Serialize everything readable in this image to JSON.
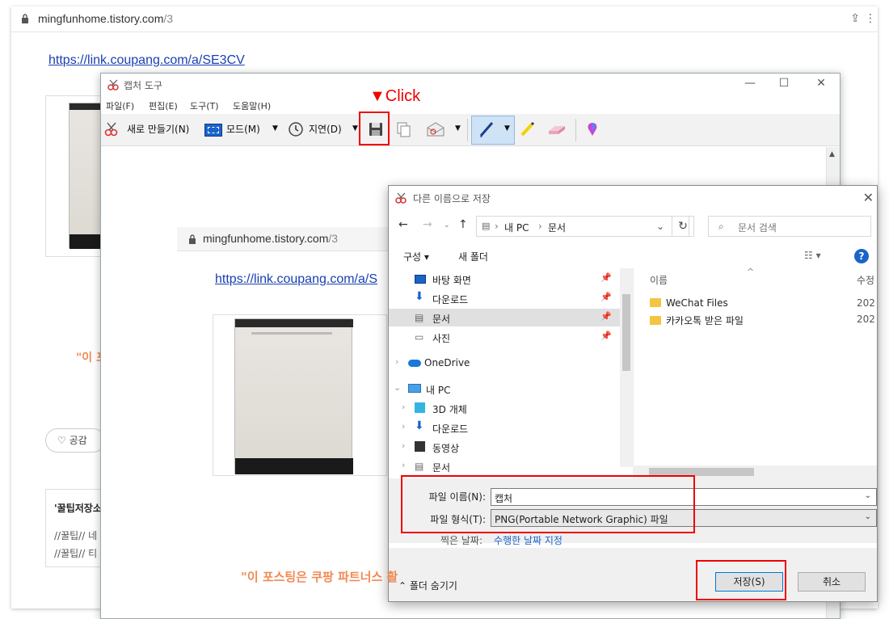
{
  "browser": {
    "url_host": "mingfunhome.tistory.com",
    "url_path": "/3",
    "link": "https://link.coupang.com/a/SE3CV",
    "orange_partial": "\"이 포",
    "like_label": "공감",
    "related_title": "'꿀팁저장소",
    "related_items": [
      "//꿀팁// 네",
      "//꿀팁// 티"
    ],
    "footer_orange": "\"이 포스팅은 쿠팡 파트너스 활"
  },
  "snipping_tool": {
    "title": "캡처 도구",
    "menu": [
      "파일(F)",
      "편집(E)",
      "도구(T)",
      "도움말(H)"
    ],
    "toolbar": {
      "new_label": "새로 만들기(N)",
      "mode_label": "모드(M)",
      "delay_label": "지연(D)"
    },
    "window_controls": [
      "—",
      "☐",
      "✕"
    ],
    "inner_url_host": "mingfunhome.tistory.com",
    "inner_url_path": "/3",
    "inner_link": "https://link.coupang.com/a/S"
  },
  "annotation": {
    "click_label": "▼Click"
  },
  "save_dialog": {
    "title": "다른 이름으로 저장",
    "breadcrumb": [
      "내 PC",
      "문서"
    ],
    "search_placeholder": "문서 검색",
    "cmd_organize": "구성 ▾",
    "cmd_new_folder": "새 폴더",
    "tree": [
      {
        "label": "바탕 화면",
        "pinned": true
      },
      {
        "label": "다운로드",
        "pinned": true
      },
      {
        "label": "문서",
        "pinned": true,
        "selected": true
      },
      {
        "label": "사진",
        "pinned": true
      },
      {
        "label": "OneDrive"
      },
      {
        "label": "내 PC"
      },
      {
        "label": "3D 개체"
      },
      {
        "label": "다운로드"
      },
      {
        "label": "동영상"
      },
      {
        "label": "문서"
      }
    ],
    "col_name": "이름",
    "col_modified": "수정",
    "files": [
      {
        "name": "WeChat Files",
        "date": "202"
      },
      {
        "name": "카카오톡 받은 파일",
        "date": "202"
      }
    ],
    "filename_label": "파일 이름(N):",
    "filename_value": "캡처",
    "filetype_label": "파일 형식(T):",
    "filetype_value": "PNG(Portable Network Graphic) 파일",
    "date_label": "찍은 날짜:",
    "date_value": "수행한 날짜 지정",
    "hide_folders": "폴더 숨기기",
    "save_button": "저장(S)",
    "cancel_button": "취소"
  }
}
